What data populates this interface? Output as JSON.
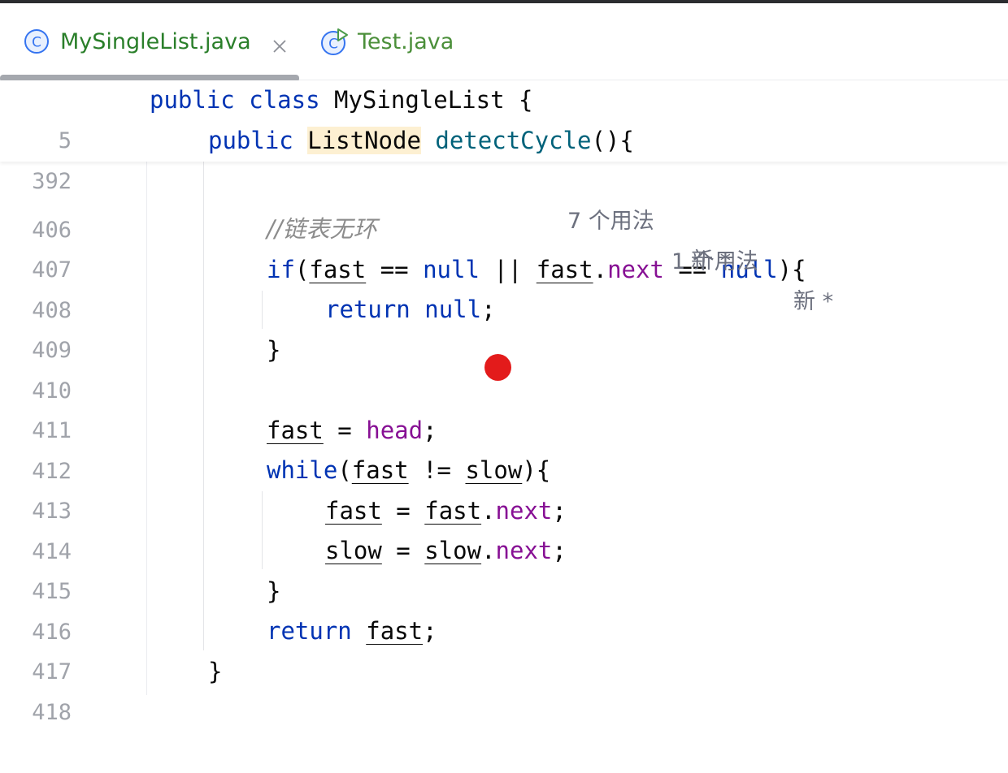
{
  "tabs": [
    {
      "label": "MySingleList.java",
      "active": true,
      "icon": "class-icon"
    },
    {
      "label": "Test.java",
      "active": false,
      "icon": "runnable-class-icon"
    }
  ],
  "sticky": [
    {
      "ln": "5",
      "kw1": "public",
      "kw2": "class",
      "name": "MySingleList",
      "brace": "{",
      "usages": "7 个用法",
      "badge": "新 *"
    },
    {
      "ln": "392",
      "kw1": "public",
      "type": "ListNode",
      "method": "detectCycle",
      "sig": "(){",
      "usages": "1 个用法",
      "badge": "新 *"
    }
  ],
  "lines": [
    {
      "ln": "406"
    },
    {
      "ln": "407",
      "comment": "//链表无环"
    },
    {
      "ln": "408",
      "kw": "if",
      "t1": "(",
      "v1": "fast",
      "t2": " == ",
      "k2": "null",
      "t3": " || ",
      "v2": "fast",
      "t4": ".",
      "f1": "next",
      "t5": " == ",
      "k3": "null",
      "t6": "){"
    },
    {
      "ln": "409",
      "kw": "return",
      "k2": "null",
      "t1": ";"
    },
    {
      "ln": "410",
      "t1": "}"
    },
    {
      "ln": "411"
    },
    {
      "ln": "412",
      "v1": "fast",
      "t1": " = ",
      "f1": "head",
      "t2": ";"
    },
    {
      "ln": "413",
      "kw": "while",
      "t1": "(",
      "v1": "fast",
      "t2": " != ",
      "v2": "slow",
      "t3": "){"
    },
    {
      "ln": "414",
      "v1": "fast",
      "t1": " = ",
      "v2": "fast",
      "t2": ".",
      "f1": "next",
      "t3": ";"
    },
    {
      "ln": "415",
      "v1": "slow",
      "t1": " = ",
      "v2": "slow",
      "t2": ".",
      "f1": "next",
      "t3": ";"
    },
    {
      "ln": "416",
      "t1": "}"
    },
    {
      "ln": "417",
      "kw": "return",
      "v1": "fast",
      "t1": ";"
    },
    {
      "ln": "418",
      "t1": "}"
    }
  ],
  "colors": {
    "keyword": "#0033b3",
    "method": "#00627a",
    "field": "#871094",
    "comment": "#8c8c8c",
    "breakpoint": "#e31b1b",
    "tab_active_text": "#2a7f2a"
  }
}
